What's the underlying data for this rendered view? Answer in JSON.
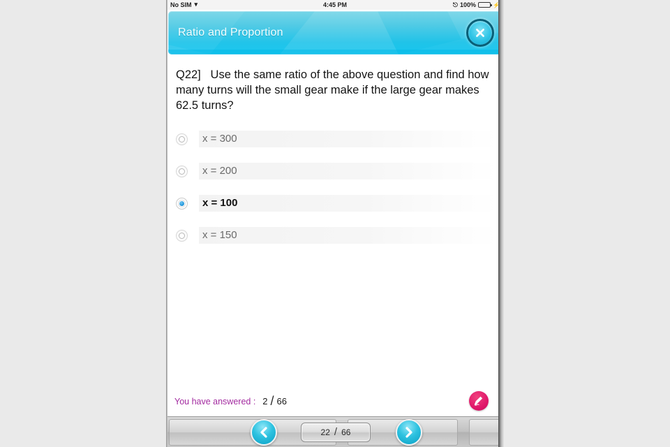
{
  "status_bar": {
    "carrier": "No SIM",
    "wifi_icon": "wifi-icon",
    "time": "4:45 PM",
    "bluetooth_icon": "bluetooth-icon",
    "battery_percent": "100%",
    "battery_icon": "battery-full-icon",
    "charging_icon": "plug-icon"
  },
  "header": {
    "title": "Ratio and Proportion",
    "close_icon": "close-icon",
    "accent_color": "#17c1e8"
  },
  "question": {
    "number": "Q22]",
    "text": "Q22]   Use the same ratio of the above question and find how many turns will the small gear make if the large gear makes 62.5 turns?"
  },
  "options": [
    {
      "label": "x = 300",
      "selected": false
    },
    {
      "label": "x = 200",
      "selected": false
    },
    {
      "label": "x = 100",
      "selected": true
    },
    {
      "label": "x = 150",
      "selected": false
    }
  ],
  "answered": {
    "label": "You have answered :",
    "count": "2",
    "separator": "/",
    "total": "66",
    "label_color": "#a32ba0"
  },
  "brand": {
    "logo_icon": "pen-logo-icon",
    "color": "#e0176a"
  },
  "toolbar": {
    "prev_icon": "chevron-left-icon",
    "next_icon": "chevron-right-icon",
    "page_current": "22",
    "page_separator": "/",
    "page_total": "66"
  }
}
